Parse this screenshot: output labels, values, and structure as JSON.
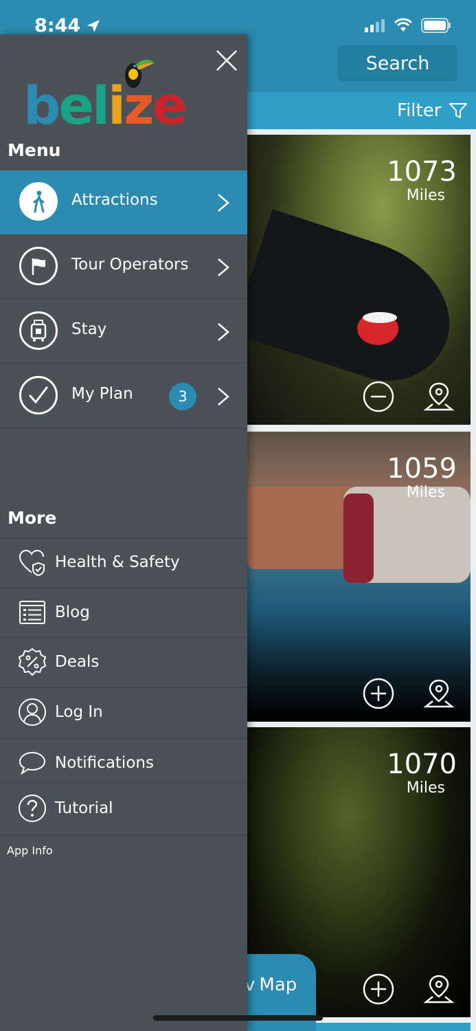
{
  "status": {
    "time": "8:44"
  },
  "header": {
    "search_label": "Search",
    "filter_label": "Filter"
  },
  "cards": [
    {
      "distance": "1073",
      "unit": "Miles",
      "action": "remove"
    },
    {
      "distance": "1059",
      "unit": "Miles",
      "action": "add"
    },
    {
      "distance": "1070",
      "unit": "Miles",
      "action": "add"
    }
  ],
  "map_button": {
    "label": "Map",
    "partial_prefix": "v"
  },
  "drawer": {
    "logo_text": "belize",
    "logo_colors": [
      "#2b8bb0",
      "#1aa387",
      "#e7a31c",
      "#e55a25",
      "#c9242b"
    ],
    "menu_title": "Menu",
    "menu_items": [
      {
        "label": "Attractions",
        "icon": "walking-person-icon",
        "active": true
      },
      {
        "label": "Tour Operators",
        "icon": "flag-icon",
        "active": false
      },
      {
        "label": "Stay",
        "icon": "luggage-icon",
        "active": false
      },
      {
        "label": "My Plan",
        "icon": "checkmark-icon",
        "active": false,
        "badge": "3"
      }
    ],
    "more_title": "More",
    "more_items": [
      {
        "label": "Health & Safety",
        "icon": "heart-shield-icon"
      },
      {
        "label": "Blog",
        "icon": "blog-list-icon"
      },
      {
        "label": "Deals",
        "icon": "percent-badge-icon"
      },
      {
        "label": "Log In",
        "icon": "user-icon"
      },
      {
        "label": "Notifications",
        "icon": "speech-bubble-icon"
      },
      {
        "label": "Tutorial",
        "icon": "question-icon"
      }
    ],
    "app_info": "App Info"
  },
  "colors": {
    "accent": "#2b8bb0",
    "drawer_bg": "#4a5257"
  }
}
